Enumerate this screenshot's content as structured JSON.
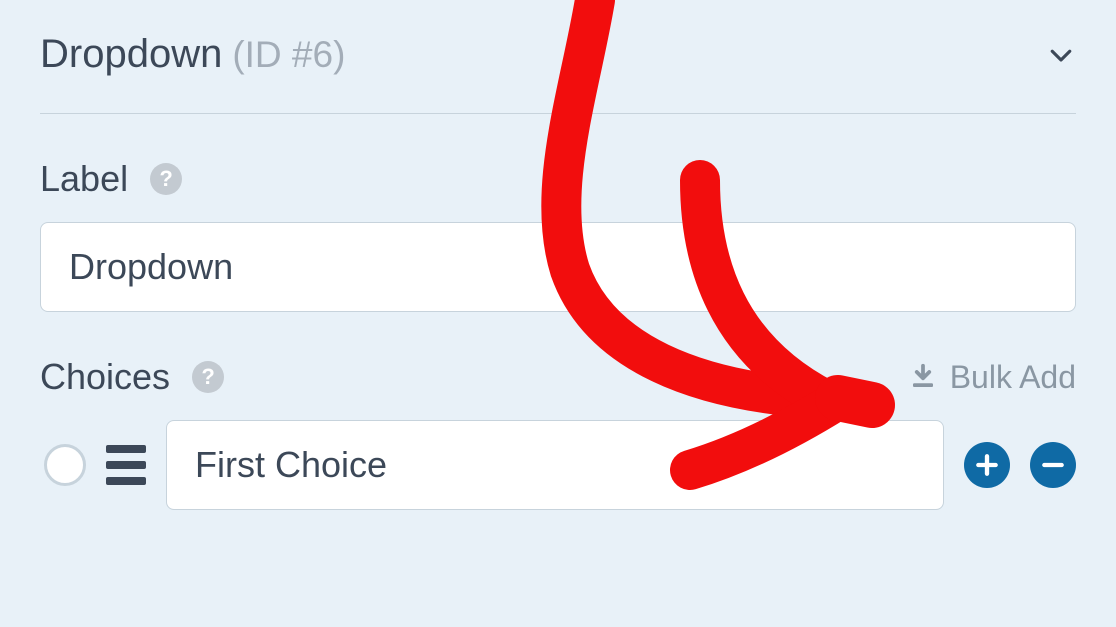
{
  "header": {
    "title": "Dropdown",
    "id_text": "(ID #6)"
  },
  "label_section": {
    "label": "Label",
    "value": "Dropdown"
  },
  "choices_section": {
    "label": "Choices",
    "bulk_add_label": "Bulk Add",
    "items": [
      {
        "value": "First Choice"
      }
    ]
  }
}
